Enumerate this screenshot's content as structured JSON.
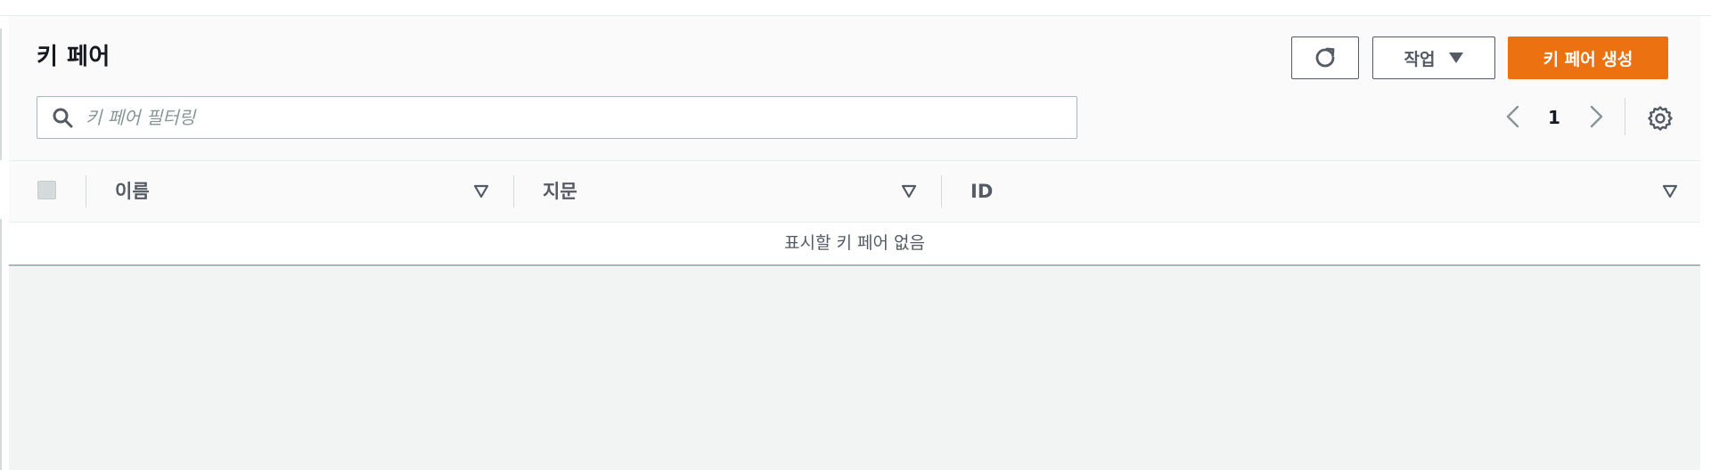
{
  "header": {
    "title": "키 페어",
    "actions_label": "작업",
    "create_label": "키 페어 생성"
  },
  "search": {
    "placeholder": "키 페어 필터링",
    "value": ""
  },
  "pagination": {
    "current_page": "1"
  },
  "table": {
    "columns": [
      "이름",
      "지문",
      "ID"
    ],
    "empty_message": "표시할 키 페어 없음"
  },
  "icons": {
    "refresh": "refresh-icon",
    "actions_caret": "caret-down-icon",
    "search": "search-icon",
    "prev": "chevron-left-icon",
    "next": "chevron-right-icon",
    "settings": "gear-icon",
    "sort": "sort-triangle-icon"
  },
  "colors": {
    "primary": "#ec7211",
    "text": "#16191f",
    "muted": "#545b64",
    "panel": "#f2f3f3"
  }
}
